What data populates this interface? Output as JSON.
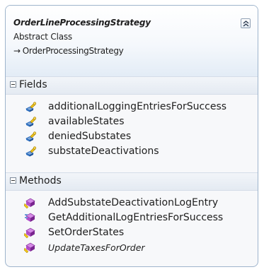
{
  "class_shape": {
    "name": "OrderLineProcessingStrategy",
    "stereotype": "Abstract Class",
    "base_arrow": "→",
    "base_class": "OrderProcessingStrategy"
  },
  "fields": {
    "title": "Fields",
    "items": [
      {
        "label": "additionalLoggingEntriesForSuccess",
        "icon": "protected-field-icon"
      },
      {
        "label": "availableStates",
        "icon": "protected-field-icon"
      },
      {
        "label": "deniedSubstates",
        "icon": "protected-field-icon"
      },
      {
        "label": "substateDeactivations",
        "icon": "protected-field-icon"
      }
    ]
  },
  "methods": {
    "title": "Methods",
    "items": [
      {
        "label": "AddSubstateDeactivationLogEntry",
        "icon": "protected-method-icon",
        "italic": false
      },
      {
        "label": "GetAdditionalLogEntriesForSuccess",
        "icon": "private-method-icon",
        "italic": false
      },
      {
        "label": "SetOrderStates",
        "icon": "protected-method-icon",
        "italic": false
      },
      {
        "label": "UpdateTaxesForOrder",
        "icon": "protected-method-icon",
        "italic": true
      }
    ]
  },
  "colors": {
    "border": "#9eb4cc",
    "field_icon": "#1f63b5",
    "method_icon": "#9b2fae",
    "key_icon": "#e8b100"
  }
}
